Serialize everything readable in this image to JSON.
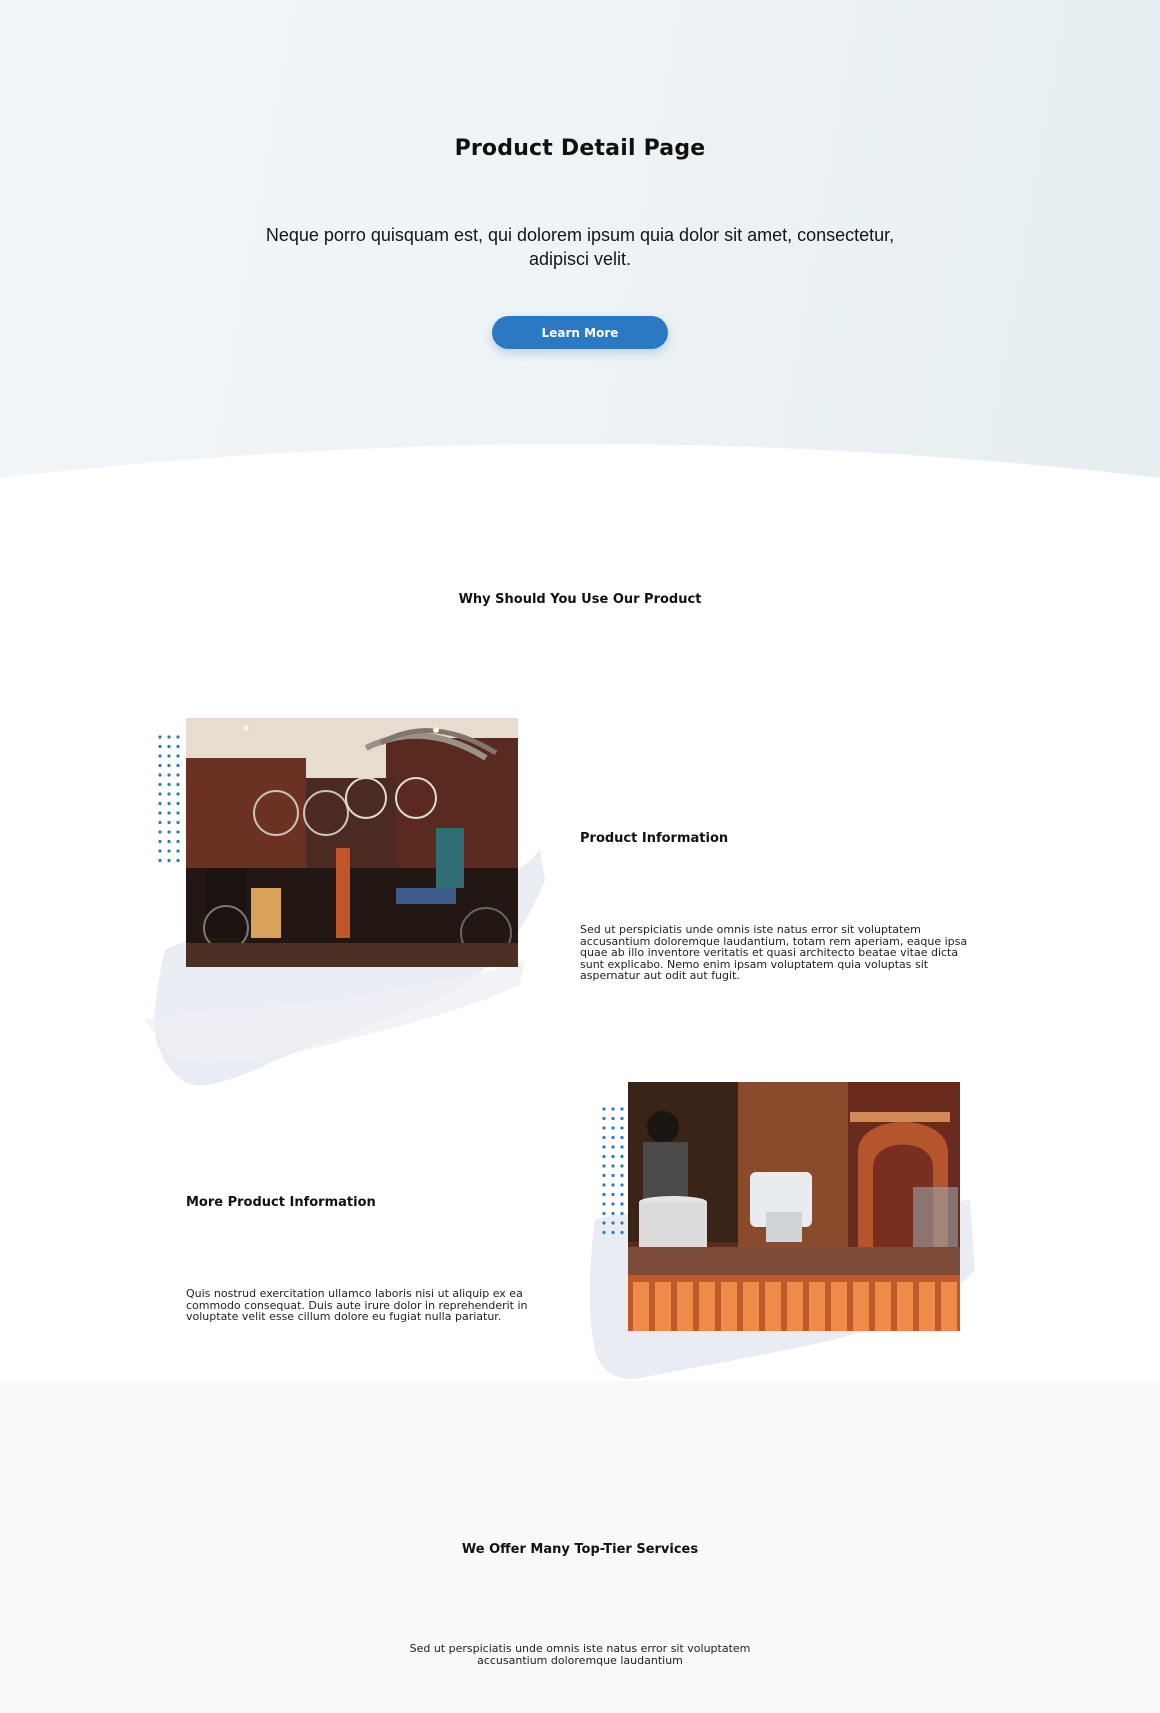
{
  "hero": {
    "title": "Product Detail Page",
    "subtitle": "Neque porro quisquam est, qui dolorem ipsum quia dolor sit amet, consectetur, adipisci velit.",
    "button_label": "Learn More"
  },
  "why": {
    "title": "Why Should You Use Our Product"
  },
  "feature1": {
    "title": "Product Information",
    "text": "Sed ut perspiciatis unde omnis iste natus error sit voluptatem accusantium doloremque laudantium, totam rem aperiam, eaque ipsa quae ab illo inventore veritatis et quasi architecto beatae vitae dicta sunt explicabo. Nemo enim ipsam voluptatem quia voluptas sit aspernatur aut odit aut fugit.",
    "image": "bicycle-shop-photo"
  },
  "feature2": {
    "title": "More Product Information",
    "text": "Quis nostrud exercitation ullamco laboris nisi ut aliquip ex ea commodo consequat. Duis aute irure dolor in reprehenderit in voluptate velit esse cillum dolore eu fugiat nulla pariatur.",
    "image": "restaurant-counter-photo"
  },
  "services": {
    "title": "We Offer Many Top-Tier Services",
    "text": "Sed ut perspiciatis unde omnis iste natus error sit voluptatem accusantium doloremque laudantium"
  },
  "colors": {
    "accent": "#2b79c2",
    "hero_bg": "#eef3f5",
    "services_bg": "#f9f9f9"
  }
}
